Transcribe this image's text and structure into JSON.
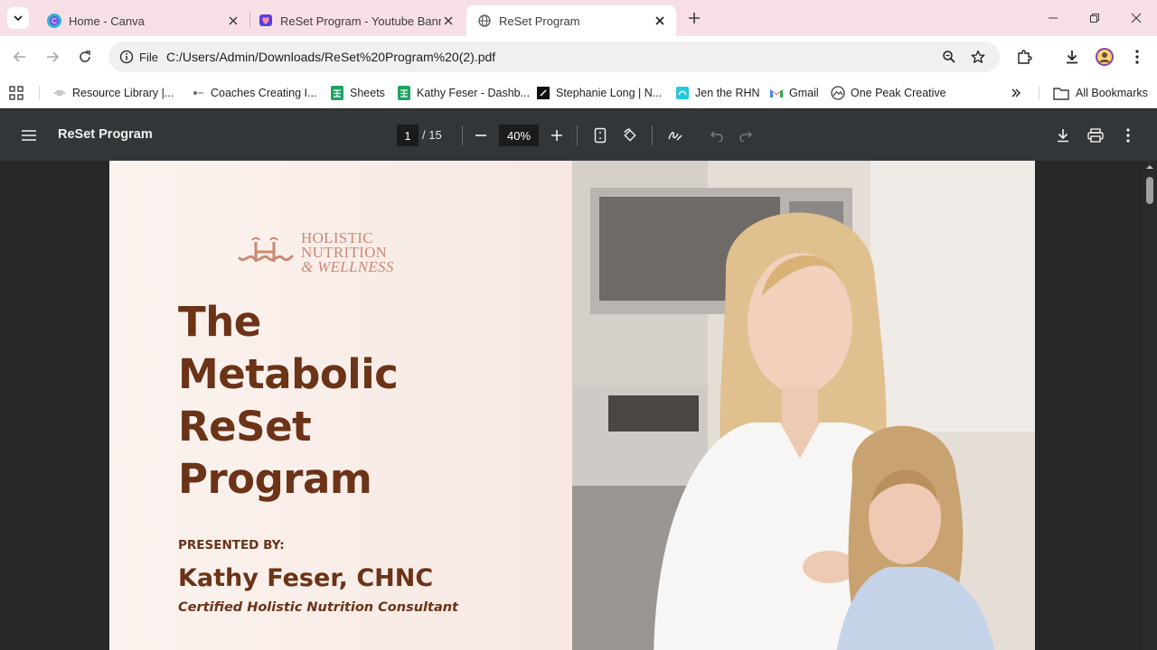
{
  "browser": {
    "tabs": [
      {
        "title": "Home - Canva",
        "icon": "canva-icon",
        "active": false
      },
      {
        "title": "ReSet Program - Youtube Bann",
        "icon": "heart-shield-icon",
        "active": false
      },
      {
        "title": "ReSet Program",
        "icon": "globe-icon",
        "active": true
      }
    ],
    "address": {
      "chip_label": "File",
      "url": "C:/Users/Admin/Downloads/ReSet%20Program%20(2).pdf"
    },
    "bookmarks": [
      {
        "label": "Resource Library |...",
        "icon": "bookmark-favicon"
      },
      {
        "label": "Coaches Creating I...",
        "icon": "bookmark-favicon"
      },
      {
        "label": "Sheets",
        "icon": "sheets-icon"
      },
      {
        "label": "Kathy Feser - Dashb...",
        "icon": "sheets-icon"
      },
      {
        "label": "Stephanie Long | N...",
        "icon": "site-favicon"
      },
      {
        "label": "Jen the RHN",
        "icon": "site-favicon"
      },
      {
        "label": "Gmail",
        "icon": "gmail-icon"
      },
      {
        "label": "One Peak Creative",
        "icon": "mountain-icon"
      }
    ],
    "all_bookmarks_label": "All Bookmarks"
  },
  "pdf_viewer": {
    "title": "ReSet Program",
    "current_page": "1",
    "page_total": "/ 15",
    "zoom": "40%"
  },
  "document": {
    "logo": {
      "line1": "HOLISTIC",
      "line2": "NUTRITION",
      "line3": "& WELLNESS"
    },
    "headline": {
      "line1": "The",
      "line2": "Metabolic",
      "line3": "ReSet",
      "line4": "Program"
    },
    "presented_by": "PRESENTED BY:",
    "presenter_name": "Kathy Feser, CHNC",
    "presenter_role": "Certified Holistic Nutrition Consultant"
  },
  "colors": {
    "tab_strip": "#f6e0e6",
    "pdf_toolbar": "#323639",
    "headline_brown": "#6b3317",
    "logo_copper": "#c98a73"
  }
}
